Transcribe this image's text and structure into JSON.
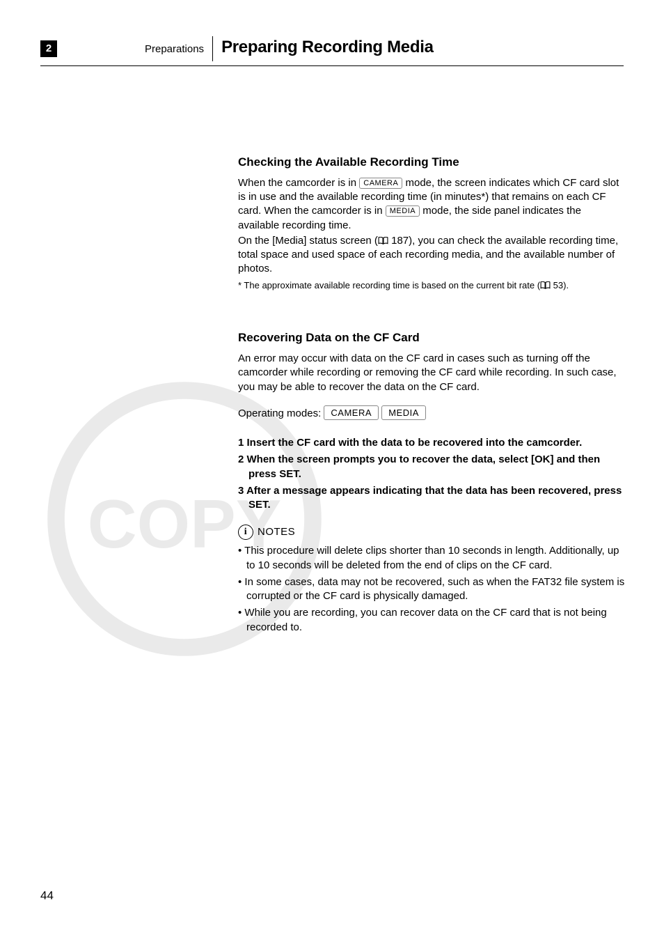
{
  "chapter_number": "2",
  "section_label": "Preparations",
  "page_title": "Preparing Recording Media",
  "page_number": "44",
  "section1": {
    "heading": "Checking the Available Recording Time",
    "p1a": "When the camcorder is in ",
    "mode1": "CAMERA",
    "p1b": " mode, the screen indicates which CF card slot is in use and the available recording time (in minutes*) that remains on each CF card. When the camcorder is in ",
    "mode2": "MEDIA",
    "p1c": " mode, the side panel indicates the available recording time.",
    "p2a": "On the [Media] status screen (",
    "ref1": " 187), you can check the available recording time, total space and used space of each recording media, and the available number of photos.",
    "footnote_a": "* The approximate available recording time is based on the current bit rate (",
    "footnote_b": " 53)."
  },
  "section2": {
    "heading": "Recovering Data on the CF Card",
    "intro": "An error may occur with data on the CF card in cases such as turning off the camcorder while recording or removing the CF card while recording. In such case, you may be able to recover the data on the CF card.",
    "op_label": "Operating modes:",
    "op_mode1": "CAMERA",
    "op_mode2": "MEDIA",
    "steps": [
      "1 Insert the CF card with the data to be recovered into the camcorder.",
      "2 When the screen prompts you to recover the data, select [OK] and then press SET.",
      "3 After a message appears indicating that the data has been recovered, press SET."
    ],
    "notes_label": "NOTES",
    "notes": [
      "This procedure will delete clips shorter than 10 seconds in length. Additionally, up to 10 seconds will be deleted from the end of clips on the CF card.",
      "In some cases, data may not be recovered, such as when the FAT32 file system is corrupted or the CF card is physically damaged.",
      "While you are recording, you can recover data on the CF card that is not being recorded to."
    ]
  }
}
